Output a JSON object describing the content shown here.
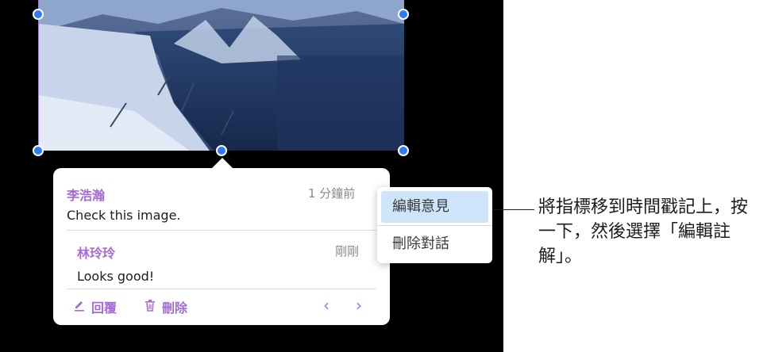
{
  "popover": {
    "comment": {
      "author": "李浩瀚",
      "time": "1 分鐘前",
      "text": "Check this image."
    },
    "reply": {
      "author": "林玲玲",
      "time": "剛剛",
      "text": "Looks good!"
    },
    "actions": {
      "reply_label": "回覆",
      "delete_label": "刪除"
    },
    "nav": {
      "prev": "‹",
      "next": "›"
    }
  },
  "menu": {
    "items": [
      {
        "label": "編輯意見",
        "highlighted": true
      },
      {
        "label": "刪除對話",
        "highlighted": false
      }
    ]
  },
  "callout": {
    "text": "將指標移到時間戳記上，按一下，然後選擇「編輯註解」。"
  },
  "colors": {
    "accent": "#a56cd8",
    "handle": "#2d7cf6",
    "highlight": "#cfe5fb"
  }
}
